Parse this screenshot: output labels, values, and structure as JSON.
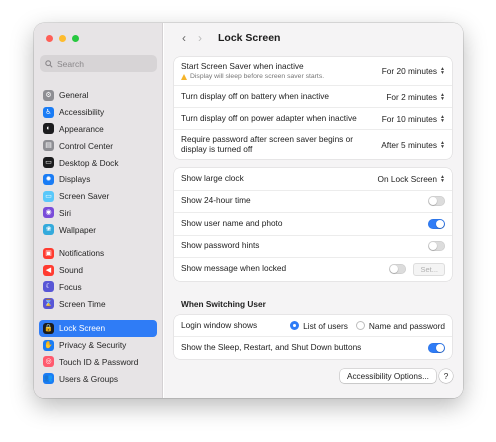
{
  "window": {
    "title": "Lock Screen"
  },
  "search": {
    "placeholder": "Search"
  },
  "sidebar": {
    "groups": [
      [
        {
          "label": "General",
          "icon": "gear-icon",
          "color": "#8e8e93",
          "glyph": "⚙"
        },
        {
          "label": "Accessibility",
          "icon": "accessibility-icon",
          "color": "#1a7cf5",
          "glyph": "♿"
        },
        {
          "label": "Appearance",
          "icon": "appearance-icon",
          "color": "#1c1c1e",
          "glyph": "◐"
        },
        {
          "label": "Control Center",
          "icon": "control-center-icon",
          "color": "#8e8e93",
          "glyph": "▤"
        },
        {
          "label": "Desktop & Dock",
          "icon": "desktop-dock-icon",
          "color": "#1c1c1e",
          "glyph": "▭"
        },
        {
          "label": "Displays",
          "icon": "displays-icon",
          "color": "#1a7cf5",
          "glyph": "✹"
        },
        {
          "label": "Screen Saver",
          "icon": "screen-saver-icon",
          "color": "#5ac8fa",
          "glyph": "▭"
        },
        {
          "label": "Siri",
          "icon": "siri-icon",
          "color": "#7a4cd9",
          "glyph": "◉"
        },
        {
          "label": "Wallpaper",
          "icon": "wallpaper-icon",
          "color": "#34aadc",
          "glyph": "❀"
        }
      ],
      [
        {
          "label": "Notifications",
          "icon": "notifications-icon",
          "color": "#ff3b30",
          "glyph": "▣"
        },
        {
          "label": "Sound",
          "icon": "sound-icon",
          "color": "#ff3b30",
          "glyph": "◀"
        },
        {
          "label": "Focus",
          "icon": "focus-icon",
          "color": "#5856d6",
          "glyph": "☾"
        },
        {
          "label": "Screen Time",
          "icon": "screen-time-icon",
          "color": "#5856d6",
          "glyph": "⌛"
        }
      ],
      [
        {
          "label": "Lock Screen",
          "icon": "lock-screen-icon",
          "color": "#1c1c1e",
          "glyph": "🔒",
          "active": true
        },
        {
          "label": "Privacy & Security",
          "icon": "privacy-icon",
          "color": "#1a7cf5",
          "glyph": "✋"
        },
        {
          "label": "Touch ID & Password",
          "icon": "touch-id-icon",
          "color": "#ff5a6e",
          "glyph": "◎"
        },
        {
          "label": "Users & Groups",
          "icon": "users-groups-icon",
          "color": "#1a7cf5",
          "glyph": "👥"
        }
      ]
    ]
  },
  "group1": {
    "screensaver": {
      "label": "Start Screen Saver when inactive",
      "sub": "Display will sleep before screen saver starts.",
      "value": "For 20 minutes"
    },
    "battery": {
      "label": "Turn display off on battery when inactive",
      "value": "For 2 minutes"
    },
    "adapter": {
      "label": "Turn display off on power adapter when inactive",
      "value": "For 10 minutes"
    },
    "password": {
      "label": "Require password after screen saver begins or display is turned off",
      "value": "After 5 minutes"
    }
  },
  "group2": {
    "large_clock": {
      "label": "Show large clock",
      "value": "On Lock Screen"
    },
    "hour24": {
      "label": "Show 24-hour time",
      "on": false
    },
    "username": {
      "label": "Show user name and photo",
      "on": true
    },
    "hints": {
      "label": "Show password hints",
      "on": false
    },
    "message": {
      "label": "Show message when locked",
      "on": false,
      "button": "Set..."
    }
  },
  "switching": {
    "heading": "When Switching User",
    "login_label": "Login window shows",
    "opt_list": "List of users",
    "opt_name": "Name and password",
    "selected": "list",
    "shutdown": {
      "label": "Show the Sleep, Restart, and Shut Down buttons",
      "on": true
    }
  },
  "footer": {
    "accessibility_button": "Accessibility Options...",
    "help": "?"
  },
  "colors": {
    "accent": "#2f7cf6",
    "sidebar_bg": "#e7e4e6"
  }
}
